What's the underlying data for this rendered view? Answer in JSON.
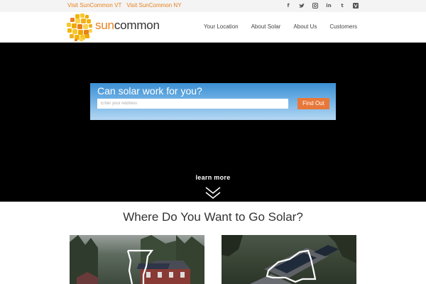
{
  "topbar": {
    "links": [
      "Visit SunCommon VT",
      "Visit SunCommon NY"
    ],
    "social_icons": [
      "facebook-icon",
      "twitter-icon",
      "instagram-icon",
      "linkedin-icon",
      "tumblr-icon",
      "vine-icon"
    ]
  },
  "header": {
    "brand_prefix": "sun",
    "brand_suffix": "common",
    "nav": [
      "Your Location",
      "About Solar",
      "About Us",
      "Customers"
    ]
  },
  "hero": {
    "search_title": "Can solar work for you?",
    "search_placeholder": "Enter your Address",
    "find_button": "Find Out",
    "learn_more": "learn more"
  },
  "section": {
    "title": "Where Do You Want to Go Solar?"
  },
  "colors": {
    "accent": "#e8801e",
    "button": "#e8783a",
    "hero_bg": "#000000"
  }
}
